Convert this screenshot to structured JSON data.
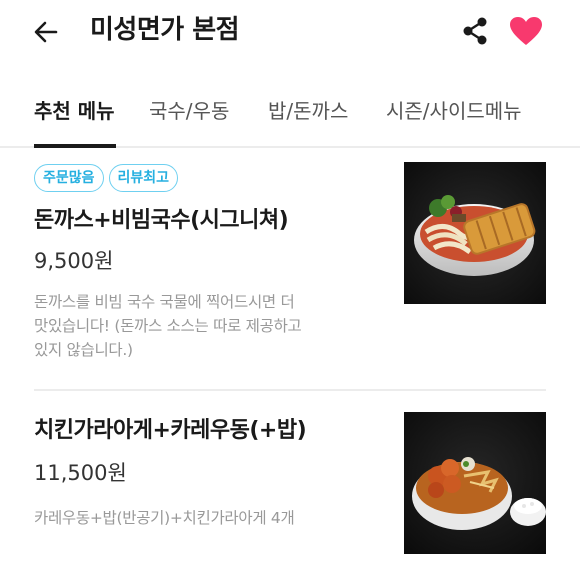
{
  "header": {
    "title": "미성면가 본점",
    "icons": {
      "back": "arrow-left-icon",
      "share": "share-icon",
      "favorite": "heart-icon"
    },
    "favorite_color": "#f8396e"
  },
  "tabs": [
    {
      "label": "추천 메뉴",
      "active": true
    },
    {
      "label": "국수/우동",
      "active": false
    },
    {
      "label": "밥/돈까스",
      "active": false
    },
    {
      "label": "시즌/사이드메뉴",
      "active": false
    }
  ],
  "menu_items": [
    {
      "badges": [
        "주문많음",
        "리뷰최고"
      ],
      "name": "돈까스+비빔국수(시그니쳐)",
      "price": "9,500원",
      "description_lines": [
        "돈까스를 비빔 국수 국물에 찍어드시면 더",
        "맛있습니다! (돈까스 소스는 따로 제공하고",
        "있지 않습니다.)"
      ]
    },
    {
      "name": "치킨가라아게+카레우동(+밥)",
      "price": "11,500원",
      "description": "카레우동+밥(반공기)+치킨가라아게 4개"
    }
  ],
  "colors": {
    "badge": "#26b0e0",
    "text_primary": "#1a1a1a",
    "text_muted": "#999999"
  }
}
